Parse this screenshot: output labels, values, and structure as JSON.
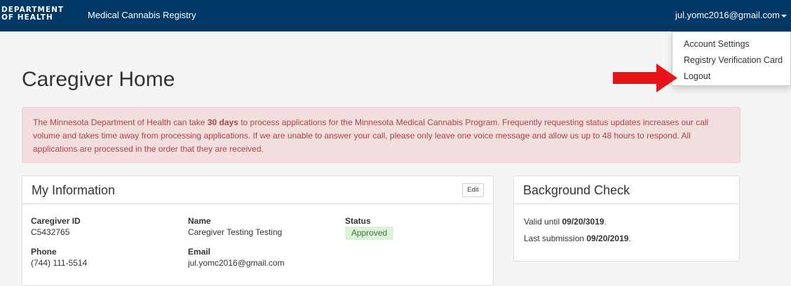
{
  "navbar": {
    "brand_line1": "DEPARTMENT",
    "brand_line2": "OF HEALTH",
    "app_title": "Medical Cannabis Registry",
    "user_email": "jul.yomc2016@gmail.com",
    "bg_color": "#003865"
  },
  "dropdown": {
    "items": [
      {
        "label": "Account Settings"
      },
      {
        "label": "Registry Verification Card"
      },
      {
        "label": "Logout"
      }
    ]
  },
  "annotation": {
    "arrow_color": "#e8141a",
    "arrow_target": "Logout"
  },
  "page": {
    "title": "Caregiver Home"
  },
  "alert": {
    "text_before_bold": "The Minnesota Department of Health can take ",
    "bold": "30 days",
    "text_after_bold": " to process applications for the Minnesota Medical Cannabis Program. Frequently requesting status updates increases our call volume and takes time away from processing applications. If we are unable to answer your call, please only leave one voice message and allow us up to 48 hours to respond. All applications are processed in the order that they are received."
  },
  "my_info": {
    "title": "My Information",
    "edit_label": "Edit",
    "caregiver_id_label": "Caregiver ID",
    "caregiver_id": "C5432765",
    "name_label": "Name",
    "name": "Caregiver Testing Testing",
    "status_label": "Status",
    "status": "Approved",
    "phone_label": "Phone",
    "phone": "(744) 111-5514",
    "email_label": "Email",
    "email": "jul.yomc2016@gmail.com"
  },
  "background_check": {
    "title": "Background Check",
    "valid_prefix": "Valid until ",
    "valid_date": "09/20/3019",
    "valid_suffix": ".",
    "submission_prefix": "Last submission ",
    "submission_date": "09/20/2019",
    "submission_suffix": "."
  }
}
